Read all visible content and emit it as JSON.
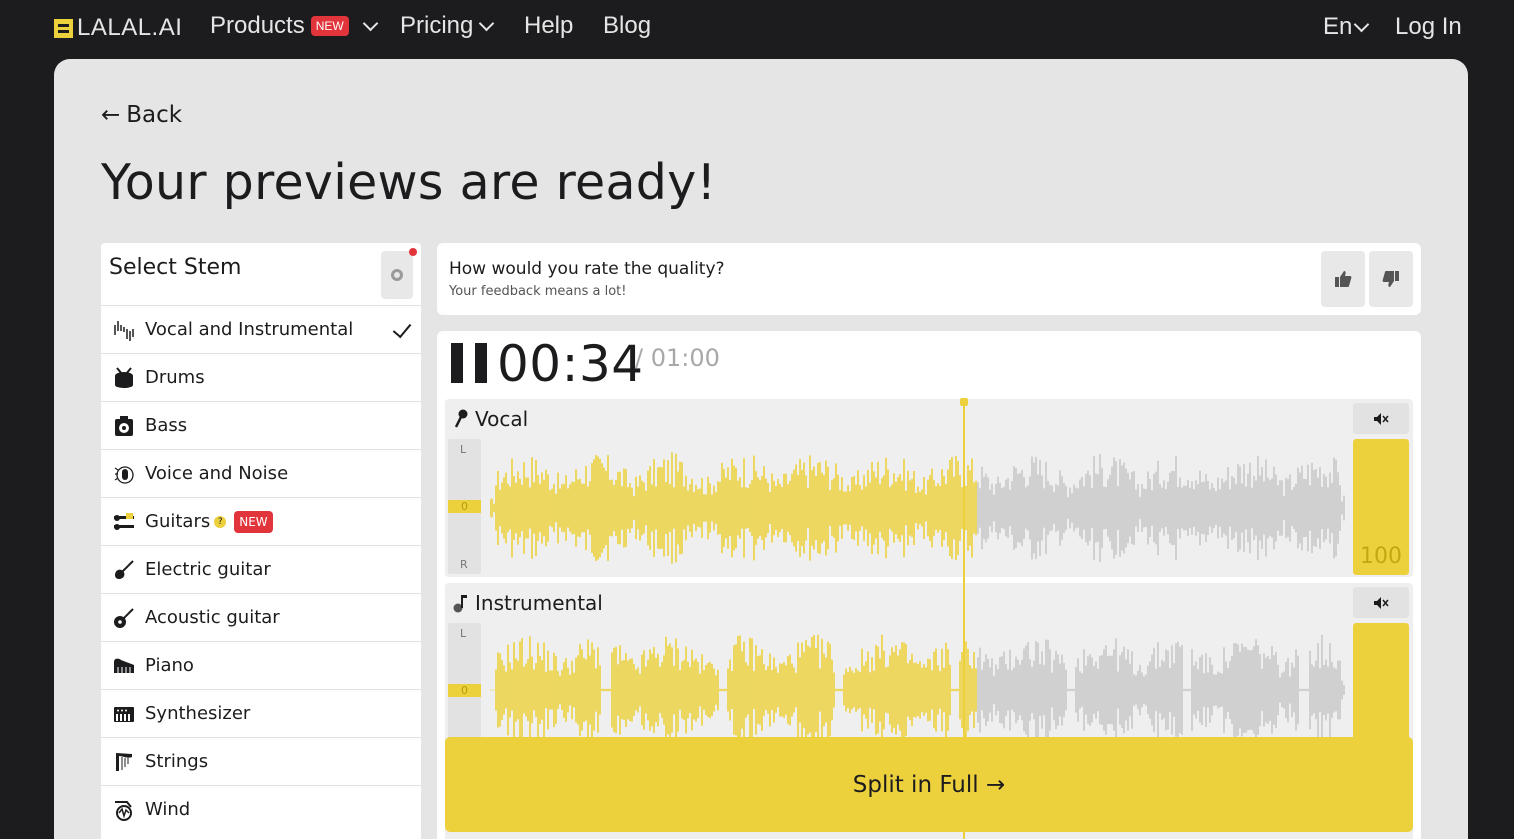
{
  "nav": {
    "logo_text": "LALAL.AI",
    "products": "Products",
    "products_badge": "NEW",
    "pricing": "Pricing",
    "help": "Help",
    "blog": "Blog",
    "lang": "En",
    "login": "Log In"
  },
  "page": {
    "back": "Back",
    "back_arrow": "←",
    "title": "Your previews are ready!"
  },
  "stems": {
    "title": "Select Stem",
    "items": [
      {
        "label": "Vocal and Instrumental",
        "icon": "waveform-icon",
        "selected": true
      },
      {
        "label": "Drums",
        "icon": "drum-icon"
      },
      {
        "label": "Bass",
        "icon": "bass-amp-icon"
      },
      {
        "label": "Voice and Noise",
        "icon": "voice-noise-icon"
      },
      {
        "label": "Guitars",
        "icon": "guitars-icon",
        "badge": "NEW",
        "help": "?"
      },
      {
        "label": "Electric guitar",
        "icon": "electric-guitar-icon"
      },
      {
        "label": "Acoustic guitar",
        "icon": "acoustic-guitar-icon"
      },
      {
        "label": "Piano",
        "icon": "piano-icon"
      },
      {
        "label": "Synthesizer",
        "icon": "synthesizer-icon"
      },
      {
        "label": "Strings",
        "icon": "harp-icon"
      },
      {
        "label": "Wind",
        "icon": "horn-icon"
      }
    ]
  },
  "feedback": {
    "question": "How would you rate the quality?",
    "sub": "Your feedback means a lot!"
  },
  "player": {
    "current_time": "00:34",
    "duration": "/ 01:00",
    "progress": 0.57,
    "tracks": [
      {
        "name": "Vocal",
        "meter_l": "L",
        "meter_zero": "0",
        "meter_r": "R",
        "volume": "100"
      },
      {
        "name": "Instrumental",
        "meter_l": "L",
        "meter_zero": "0"
      }
    ]
  },
  "split_button": "Split in Full →",
  "colors": {
    "accent": "#ecd13d",
    "badge": "#e2343b",
    "background": "#1c1c1e",
    "card": "#e5e5e5"
  }
}
